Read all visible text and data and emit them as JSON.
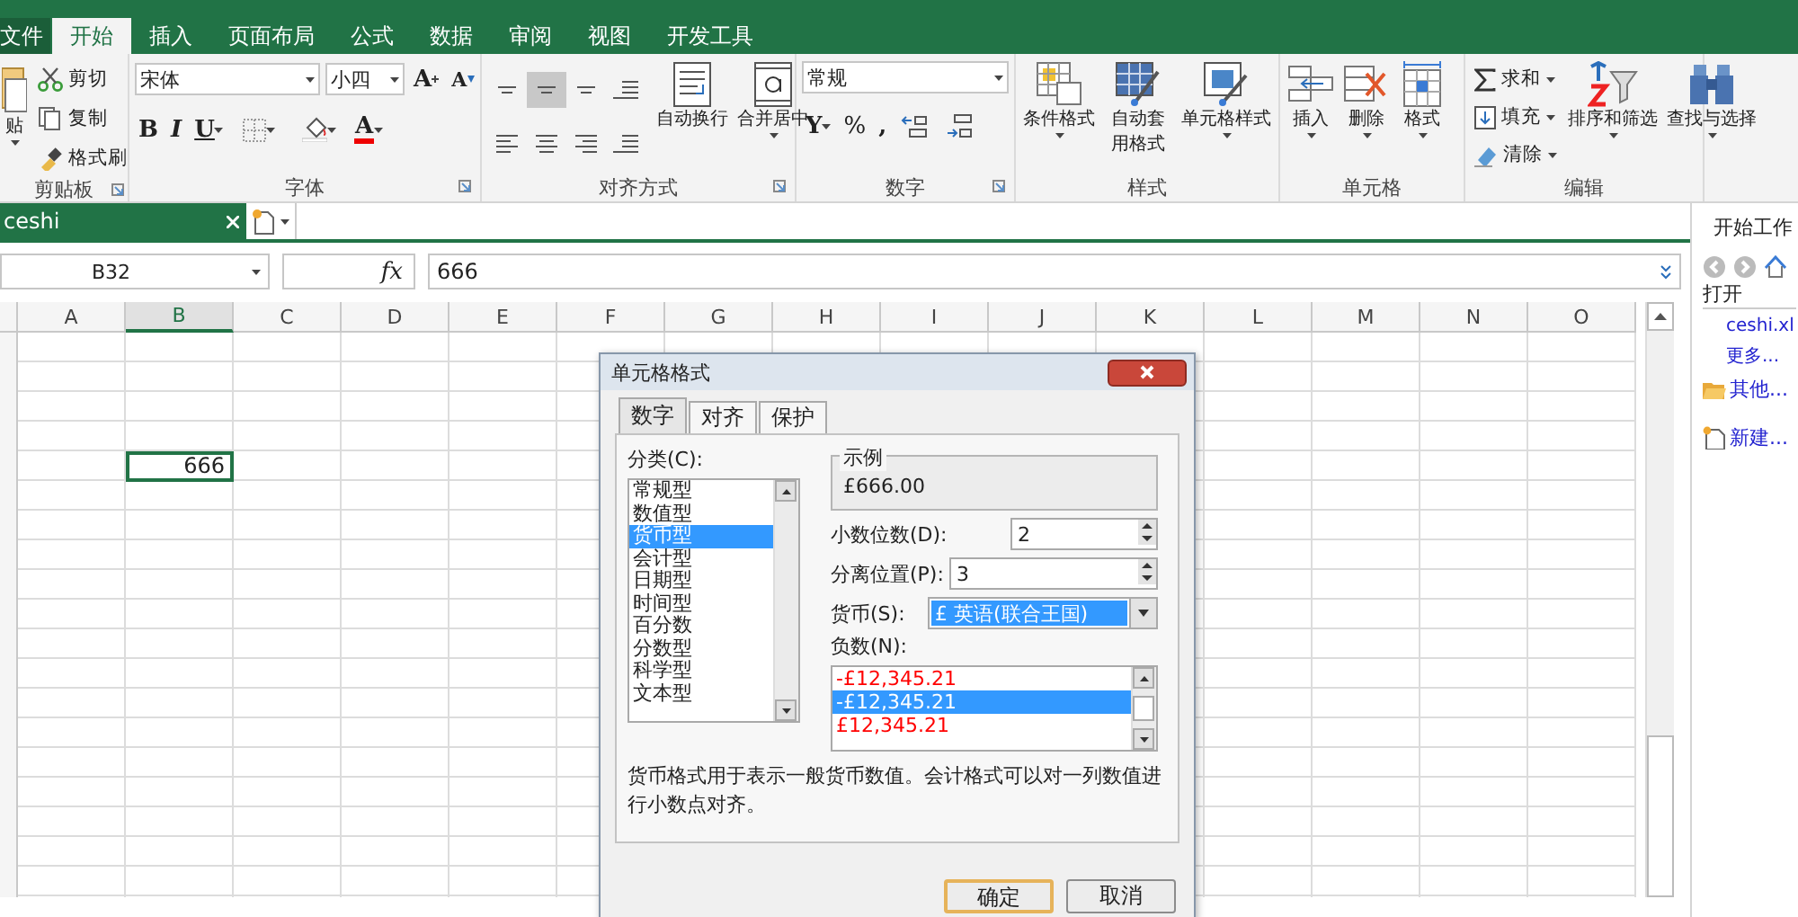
{
  "ribbon_tabs": [
    {
      "label": "文件",
      "selected": false,
      "kind": "file"
    },
    {
      "label": "开始",
      "selected": true,
      "kind": "tab"
    },
    {
      "label": "插入",
      "selected": false,
      "kind": "tab"
    },
    {
      "label": "页面布局",
      "selected": false,
      "kind": "tab"
    },
    {
      "label": "公式",
      "selected": false,
      "kind": "tab"
    },
    {
      "label": "数据",
      "selected": false,
      "kind": "tab"
    },
    {
      "label": "审阅",
      "selected": false,
      "kind": "tab"
    },
    {
      "label": "视图",
      "selected": false,
      "kind": "tab"
    },
    {
      "label": "开发工具",
      "selected": false,
      "kind": "tab"
    }
  ],
  "ribbon": {
    "clipboard": {
      "title": "剪贴板",
      "paste": "贴",
      "cut": "剪切",
      "copy": "复制",
      "painter": "格式刷"
    },
    "font": {
      "title": "字体",
      "font_name": "宋体",
      "font_size": "小四",
      "grow": "A",
      "shrink": "A",
      "bold": "B",
      "italic": "I",
      "underline": "U",
      "font_color": "A"
    },
    "alignment": {
      "title": "对齐方式",
      "wrap": "自动换行",
      "merge": "合并居中"
    },
    "number": {
      "title": "数字",
      "format": "常规",
      "currency": "Y",
      "percent": "%",
      "comma": ","
    },
    "styles": {
      "title": "样式",
      "conditional": "条件格式",
      "autoformat": "自动套用格式",
      "cell_styles": "单元格样式"
    },
    "cells": {
      "title": "单元格",
      "insert": "插入",
      "delete": "删除",
      "format": "格式"
    },
    "editing": {
      "title": "编辑",
      "sum": "求和",
      "fill": "填充",
      "clear": "清除",
      "sort": "排序和筛选",
      "find": "查找与选择"
    }
  },
  "document_tabs": [
    {
      "label": "ceshi",
      "selected": true
    }
  ],
  "formula_bar": {
    "name_box": "B32",
    "function_label": "fx",
    "value": "666"
  },
  "sheet": {
    "columns": [
      {
        "label": "A",
        "selected": false
      },
      {
        "label": "B",
        "selected": true,
        "active_value": "666"
      },
      {
        "label": "C",
        "selected": false
      },
      {
        "label": "D",
        "selected": false
      },
      {
        "label": "E",
        "selected": false
      },
      {
        "label": "F",
        "selected": false
      },
      {
        "label": "G",
        "selected": false
      },
      {
        "label": "H",
        "selected": false
      },
      {
        "label": "I",
        "selected": false
      },
      {
        "label": "J",
        "selected": false
      },
      {
        "label": "K",
        "selected": false
      },
      {
        "label": "L",
        "selected": false
      },
      {
        "label": "M",
        "selected": false
      },
      {
        "label": "N",
        "selected": false
      },
      {
        "label": "O",
        "selected": false
      }
    ]
  },
  "dialog": {
    "title": "单元格格式",
    "tabs": [
      {
        "label": "数字",
        "selected": true
      },
      {
        "label": "对齐",
        "selected": false
      },
      {
        "label": "保护",
        "selected": false
      }
    ],
    "category_label": "分类(C):",
    "categories": [
      {
        "label": "常规型",
        "selected": false
      },
      {
        "label": "数值型",
        "selected": false
      },
      {
        "label": "货币型",
        "selected": true
      },
      {
        "label": "会计型",
        "selected": false
      },
      {
        "label": "日期型",
        "selected": false
      },
      {
        "label": "时间型",
        "selected": false
      },
      {
        "label": "百分数",
        "selected": false
      },
      {
        "label": "分数型",
        "selected": false
      },
      {
        "label": "科学型",
        "selected": false
      },
      {
        "label": "文本型",
        "selected": false
      }
    ],
    "sample_label": "示例",
    "sample_value": "£666.00",
    "decimals_label": "小数位数(D):",
    "decimals_value": "2",
    "separator_label": "分离位置(P):",
    "separator_value": "3",
    "currency_label": "货币(S):",
    "currency_value": "£ 英语(联合王国)",
    "negative_label": "负数(N):",
    "negatives": [
      {
        "label": "-£12,345.21",
        "selected": false,
        "kind": "red"
      },
      {
        "label": "-£12,345.21",
        "selected": true,
        "kind": "plain"
      },
      {
        "label": "£12,345.21",
        "selected": false,
        "kind": "red"
      }
    ],
    "description": "货币格式用于表示一般货币数值。会计格式可以对一列数值进行小数点对齐。",
    "buttons": [
      {
        "label": "确定",
        "kind": "default"
      },
      {
        "label": "取消",
        "kind": "normal"
      }
    ]
  },
  "task_pane": {
    "title": "开始工作",
    "open_label": "打开",
    "links": [
      {
        "label": "ceshi.xl",
        "kind": "file"
      },
      {
        "label": "更多...",
        "kind": "more"
      },
      {
        "label": "其他...",
        "kind": "folder"
      },
      {
        "label": "新建...",
        "kind": "new"
      }
    ]
  }
}
